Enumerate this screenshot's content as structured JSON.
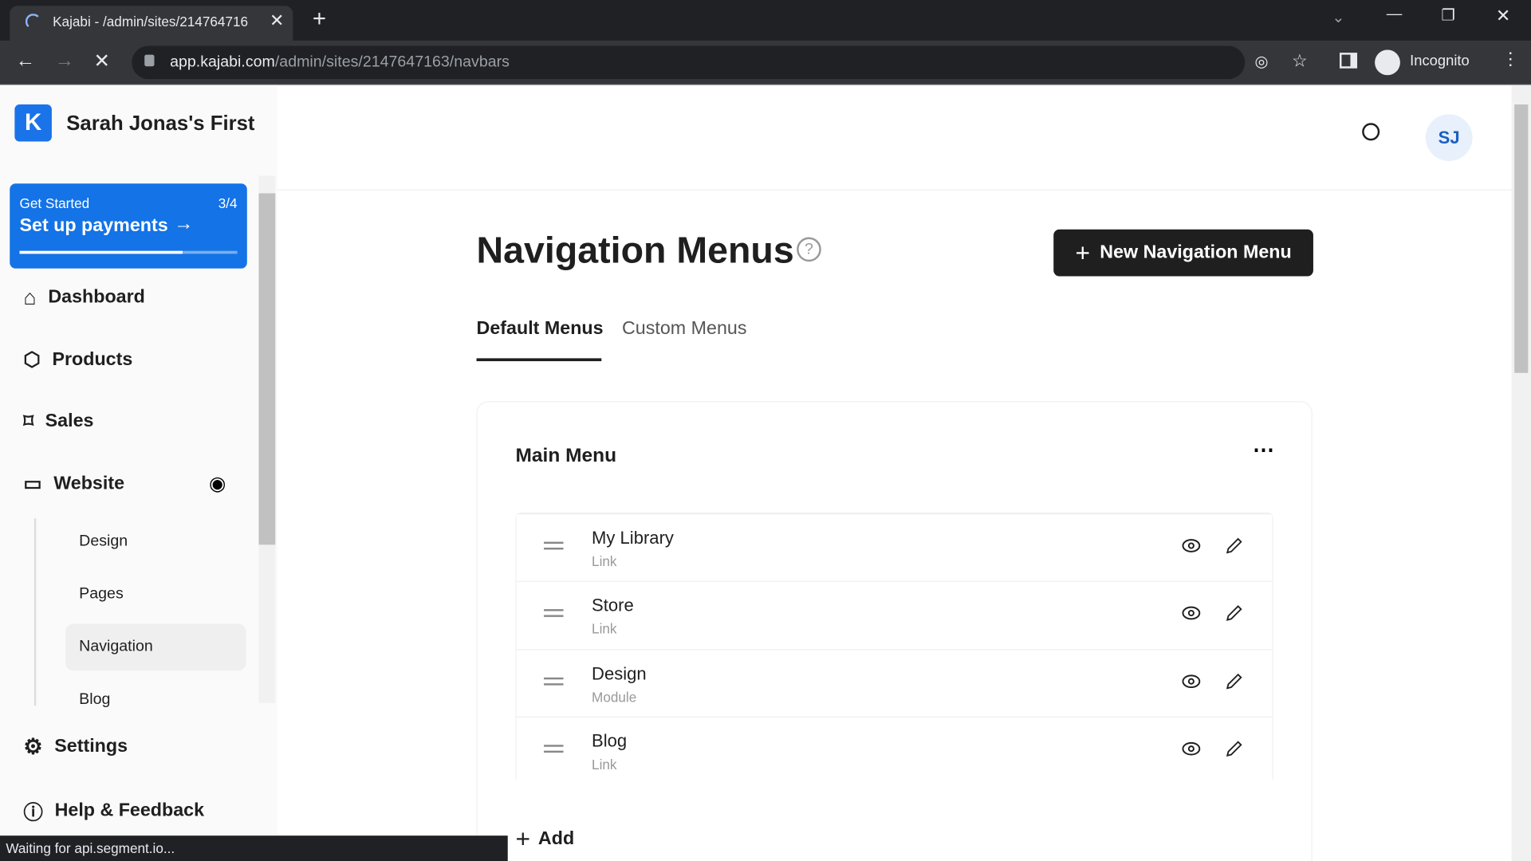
{
  "browser": {
    "tab_title": "Kajabi - /admin/sites/214764716",
    "url_host": "app.kajabi.com",
    "url_path": "/admin/sites/2147647163/navbars",
    "profile": "Incognito",
    "status": "Waiting for api.segment.io..."
  },
  "sidebar": {
    "site_name": "Sarah Jonas's First",
    "get_started": {
      "label": "Get Started",
      "count": "3/4",
      "action": "Set up payments",
      "progress": 0.75
    },
    "items": [
      {
        "label": "Dashboard",
        "icon": "home-icon"
      },
      {
        "label": "Products",
        "icon": "box-icon"
      },
      {
        "label": "Sales",
        "icon": "tag-icon"
      },
      {
        "label": "Website",
        "icon": "monitor-icon"
      }
    ],
    "website_sub": [
      {
        "label": "Design"
      },
      {
        "label": "Pages"
      },
      {
        "label": "Navigation",
        "active": true
      },
      {
        "label": "Blog"
      }
    ],
    "bottom": [
      {
        "label": "Settings",
        "icon": "gear-icon"
      },
      {
        "label": "Help & Feedback",
        "icon": "help-icon"
      }
    ]
  },
  "header": {
    "avatar": "SJ"
  },
  "main": {
    "title": "Navigation Menus",
    "new_button": "New Navigation Menu",
    "tabs": [
      {
        "label": "Default Menus",
        "active": true
      },
      {
        "label": "Custom Menus"
      }
    ],
    "menu": {
      "title": "Main Menu",
      "items": [
        {
          "name": "My Library",
          "type": "Link"
        },
        {
          "name": "Store",
          "type": "Link"
        },
        {
          "name": "Design",
          "type": "Module"
        },
        {
          "name": "Blog",
          "type": "Link"
        }
      ],
      "add_label": "Add"
    }
  },
  "colors": {
    "accent": "#1a73e8",
    "button": "#1f1f1f"
  }
}
